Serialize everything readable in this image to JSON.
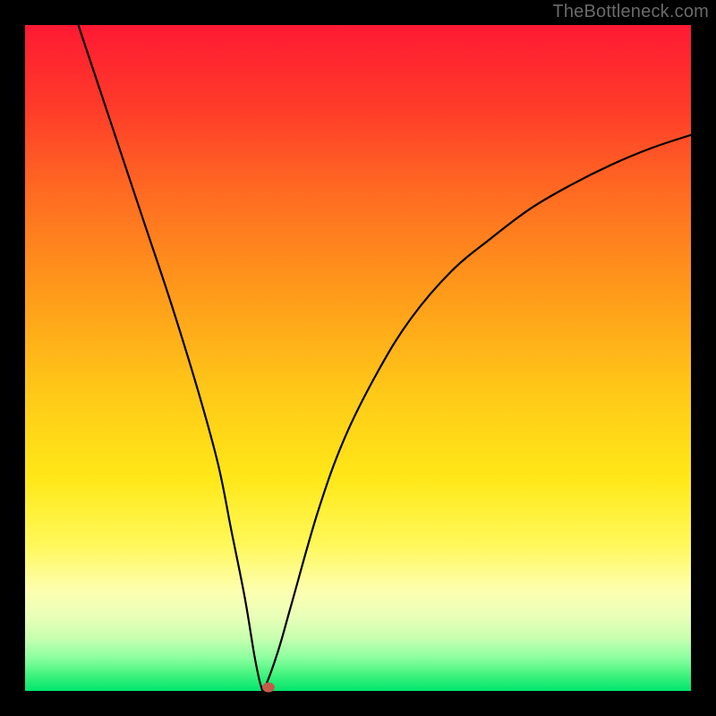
{
  "watermark": "TheBottleneck.com",
  "colors": {
    "frame": "#000000",
    "curve": "#000000",
    "dot": "#c45a4a"
  },
  "chart_data": {
    "type": "line",
    "title": "",
    "xlabel": "",
    "ylabel": "",
    "xlim": [
      0,
      100
    ],
    "ylim": [
      0,
      100
    ],
    "grid": false,
    "series": [
      {
        "name": "curve",
        "x": [
          8,
          10,
          14,
          18,
          22,
          26,
          29,
          31,
          33,
          34.5,
          35.5,
          36,
          38,
          40,
          44,
          48,
          53,
          58,
          64,
          70,
          76,
          82,
          88,
          94,
          100
        ],
        "values": [
          100,
          94,
          82,
          70,
          58,
          45,
          34,
          24,
          14,
          5,
          0.5,
          0.5,
          6,
          13,
          27,
          38,
          48,
          56,
          63,
          68,
          72.5,
          76,
          79,
          81.5,
          83.5
        ]
      }
    ],
    "marker": {
      "x": 36.5,
      "y": 0.5
    },
    "axes_visible": false
  }
}
